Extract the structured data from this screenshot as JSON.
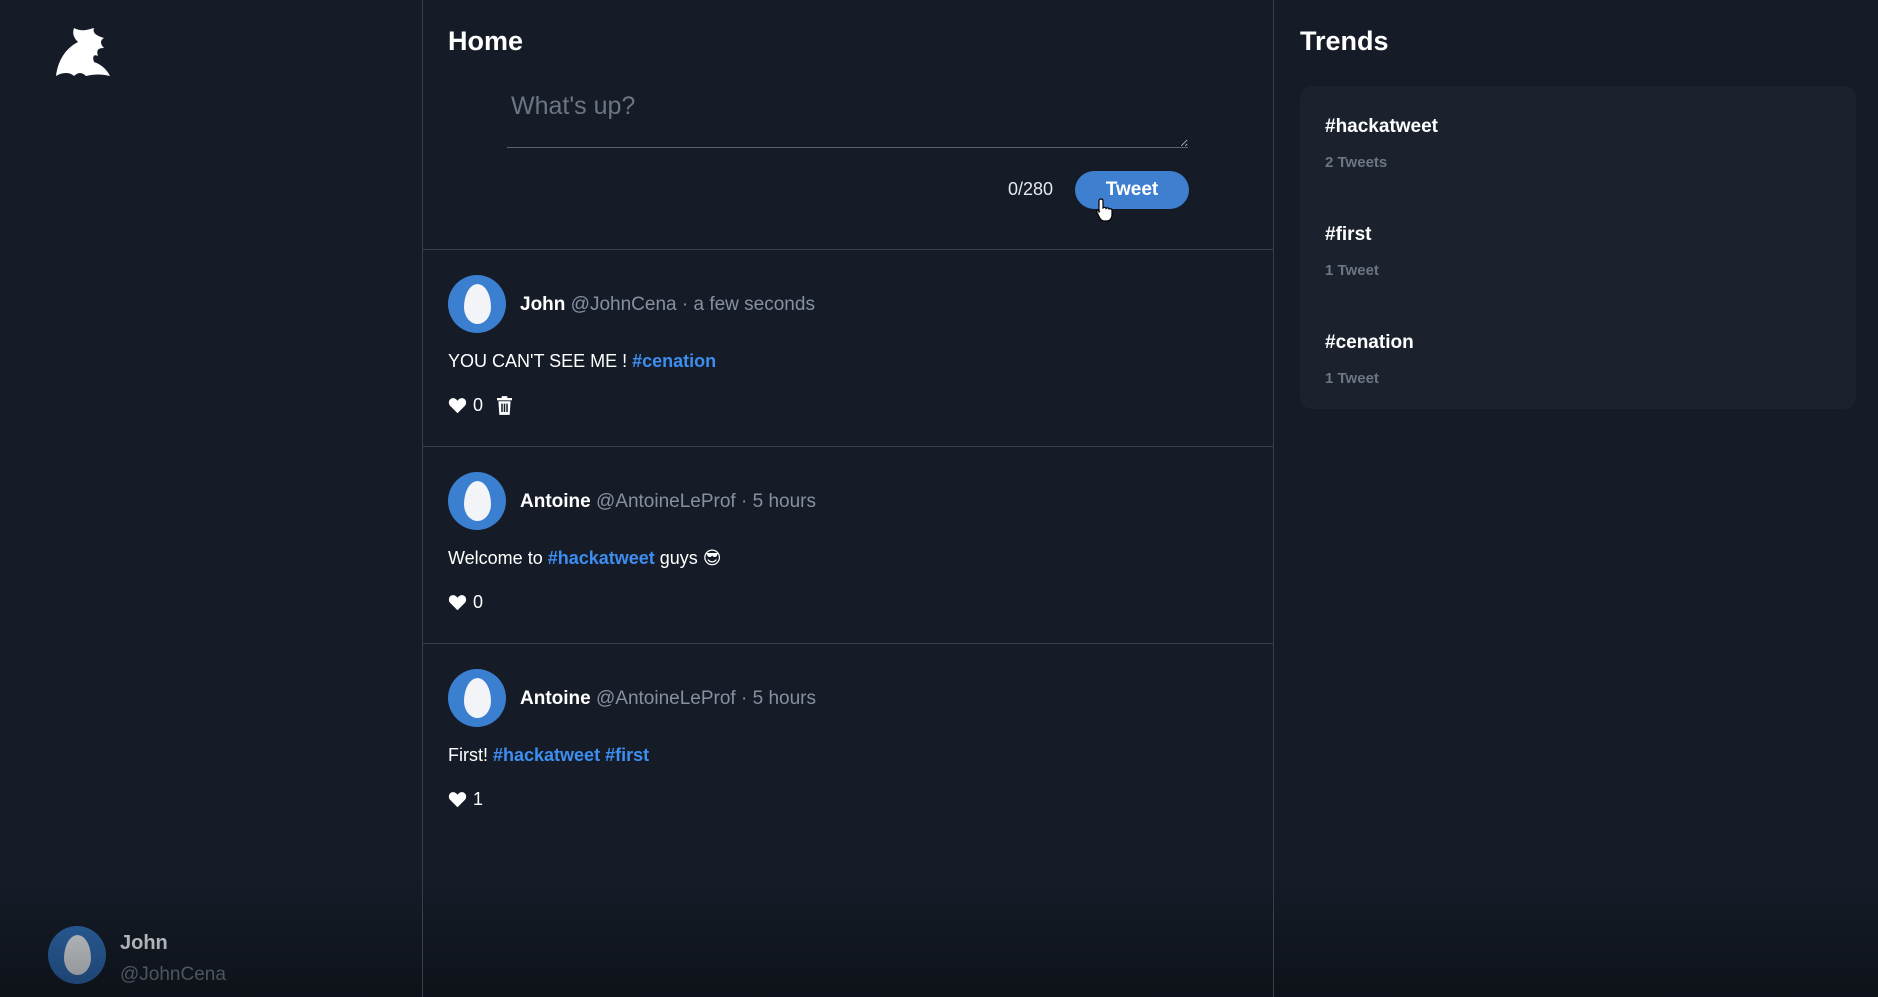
{
  "sidebar": {
    "logo_icon": "bird-wing-icon",
    "user": {
      "name": "John",
      "handle": "@JohnCena"
    }
  },
  "feed": {
    "title": "Home",
    "composer": {
      "placeholder": "What's up?",
      "char_count": "0/280",
      "tweet_button": "Tweet"
    },
    "tweets": [
      {
        "name": "John",
        "handle": "@JohnCena",
        "separator": "·",
        "time": "a few seconds",
        "text": "YOU CAN'T SEE ME ! ",
        "hashtags": [
          "#cenation"
        ],
        "likes": "0",
        "deletable": true
      },
      {
        "name": "Antoine",
        "handle": "@AntoineLeProf",
        "separator": "·",
        "time": "5 hours",
        "text_before": "Welcome to ",
        "hashtags": [
          "#hackatweet"
        ],
        "text_after": " guys 😎",
        "likes": "0"
      },
      {
        "name": "Antoine",
        "handle": "@AntoineLeProf",
        "separator": "·",
        "time": "5 hours",
        "text": "First! ",
        "hashtags": [
          "#hackatweet",
          "#first"
        ],
        "likes": "1"
      }
    ]
  },
  "trends": {
    "title": "Trends",
    "items": [
      {
        "tag": "#hackatweet",
        "count": "2 Tweets"
      },
      {
        "tag": "#first",
        "count": "1 Tweet"
      },
      {
        "tag": "#cenation",
        "count": "1 Tweet"
      }
    ]
  },
  "colors": {
    "background": "#151c27",
    "accent": "#3f7fcf",
    "hashtag": "#3d8ef0",
    "muted": "#8590a0",
    "panel": "#1b222d"
  }
}
